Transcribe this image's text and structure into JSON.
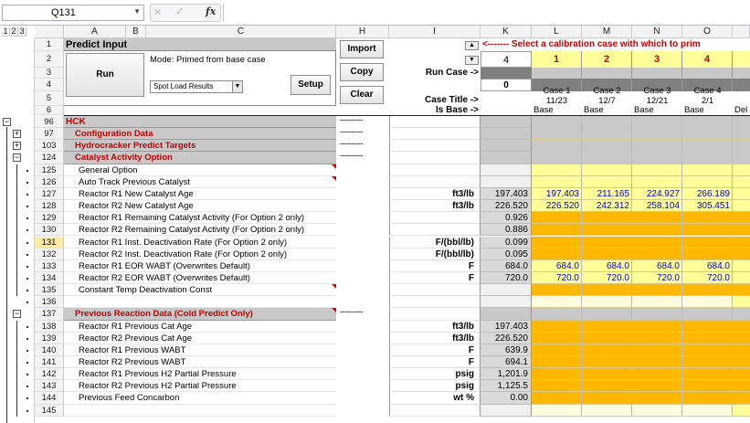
{
  "formula_bar": {
    "name_box": "Q131",
    "fx": "fx"
  },
  "outline_levels": [
    "1",
    "2",
    "3"
  ],
  "columns": [
    "A",
    "B",
    "C",
    "H",
    "I",
    "K",
    "L",
    "M",
    "N",
    "O"
  ],
  "panel": {
    "title": "Predict Input",
    "run": "Run",
    "mode": "Mode: Primed from base case",
    "dropdown": "Spot Load Results",
    "setup": "Setup",
    "import": "Import",
    "copy": "Copy",
    "clear": "Clear"
  },
  "header_area": {
    "calib_msg": "<------- Select a calibration case with which to prim",
    "run_case_label": "Run Case ->",
    "case_title_label": "Case Title ->",
    "is_base_label": "Is Base ->",
    "k2": "4",
    "k4": "0",
    "cases": [
      {
        "num": "1",
        "name": "Case 1",
        "date": "11/23",
        "base": "Base"
      },
      {
        "num": "2",
        "name": "Case 2",
        "date": "12/7",
        "base": "Base"
      },
      {
        "num": "3",
        "name": "Case 3",
        "date": "12/21",
        "base": "Base"
      },
      {
        "num": "4",
        "name": "Case 4",
        "date": "2/1",
        "base": "Base"
      }
    ],
    "p6": "Del"
  },
  "top_rows": [
    "1",
    "2",
    "3",
    "4",
    "5",
    "6"
  ],
  "rows": [
    {
      "r": "96",
      "label": "HCK",
      "indent": 0,
      "kind": "hck",
      "unit": "",
      "k": "",
      "vals": []
    },
    {
      "r": "97",
      "label": "Configuration Data",
      "indent": 1,
      "kind": "section",
      "unit": "",
      "k": "",
      "vals": []
    },
    {
      "r": "103",
      "label": "Hydrocracker Predict Targets",
      "indent": 1,
      "kind": "section",
      "unit": "",
      "k": "",
      "vals": []
    },
    {
      "r": "124",
      "label": "Catalyst Activity Option",
      "indent": 1,
      "kind": "section",
      "unit": "",
      "k": "",
      "vals": []
    },
    {
      "r": "125",
      "label": "General Option",
      "indent": 2,
      "kind": "item",
      "unit": "",
      "k": "",
      "vals": [],
      "tri": true
    },
    {
      "r": "126",
      "label": "Auto Track Previous Catalyst",
      "indent": 2,
      "kind": "item",
      "unit": "",
      "k": "",
      "vals": [],
      "tri": true
    },
    {
      "r": "127",
      "label": "Reactor R1 New Catalyst Age",
      "indent": 2,
      "kind": "item",
      "unit": "ft3/lb",
      "k": "197.403",
      "vals": [
        "197.403",
        "211.165",
        "224.927",
        "266.189"
      ]
    },
    {
      "r": "128",
      "label": "Reactor R2 New Catalyst Age",
      "indent": 2,
      "kind": "item",
      "unit": "ft3/lb",
      "k": "226.520",
      "vals": [
        "226.520",
        "242.312",
        "258.104",
        "305.451"
      ]
    },
    {
      "r": "129",
      "label": "Reactor R1 Remaining Catalyst Activity (For Option 2 only)",
      "indent": 2,
      "kind": "orange",
      "unit": "",
      "k": "0.926",
      "vals": []
    },
    {
      "r": "130",
      "label": "Reactor R2 Remaining Catalyst Activity (For Option 2 only)",
      "indent": 2,
      "kind": "orange",
      "unit": "",
      "k": "0.886",
      "vals": []
    },
    {
      "r": "131",
      "label": "Reactor R1 Inst. Deactivation Rate (For Option 2 only)",
      "indent": 2,
      "kind": "orange",
      "unit": "F/(bbl/lb)",
      "k": "0.099",
      "vals": [],
      "sel": true
    },
    {
      "r": "132",
      "label": "Reactor R2 Inst. Deactivation Rate (For Option 2 only)",
      "indent": 2,
      "kind": "orange",
      "unit": "F/(bbl/lb)",
      "k": "0.095",
      "vals": []
    },
    {
      "r": "133",
      "label": "Reactor R1 EOR WABT (Overwrites Default)",
      "indent": 2,
      "kind": "item",
      "unit": "F",
      "k": "684.0",
      "vals": [
        "684.0",
        "684.0",
        "684.0",
        "684.0"
      ]
    },
    {
      "r": "134",
      "label": "Reactor R2 EOR WABT (Overwrites Default)",
      "indent": 2,
      "kind": "item",
      "unit": "F",
      "k": "720.0",
      "vals": [
        "720.0",
        "720.0",
        "720.0",
        "720.0"
      ]
    },
    {
      "r": "135",
      "label": "Constant Temp Deactivation Const",
      "indent": 2,
      "kind": "orange",
      "unit": "",
      "k": "",
      "vals": [],
      "tri": true
    },
    {
      "r": "136",
      "label": "",
      "indent": 2,
      "kind": "blank",
      "unit": "",
      "k": "",
      "vals": []
    },
    {
      "r": "137",
      "label": "Previous Reaction Data (Cold Predict Only)",
      "indent": 1,
      "kind": "section",
      "unit": "",
      "k": "",
      "vals": [],
      "tri": true
    },
    {
      "r": "138",
      "label": "Reactor R1 Previous Cat Age",
      "indent": 2,
      "kind": "orange",
      "unit": "ft3/lb",
      "k": "197.403",
      "vals": []
    },
    {
      "r": "139",
      "label": "Reactor R2 Previous Cat Age",
      "indent": 2,
      "kind": "orange",
      "unit": "ft3/lb",
      "k": "226.520",
      "vals": []
    },
    {
      "r": "140",
      "label": "Reactor R1 Previous WABT",
      "indent": 2,
      "kind": "orange",
      "unit": "F",
      "k": "639.9",
      "vals": []
    },
    {
      "r": "141",
      "label": "Reactor R2 Previous WABT",
      "indent": 2,
      "kind": "orange",
      "unit": "F",
      "k": "694.1",
      "vals": []
    },
    {
      "r": "142",
      "label": "Reactor R1 Previous H2 Partial Pressure",
      "indent": 2,
      "kind": "orange",
      "unit": "psig",
      "k": "1,201.9",
      "vals": []
    },
    {
      "r": "143",
      "label": "Reactor R2 Previous H2 Partial Pressure",
      "indent": 2,
      "kind": "orange",
      "unit": "psig",
      "k": "1,125.5",
      "vals": []
    },
    {
      "r": "144",
      "label": "Previous Feed Concarbon",
      "indent": 2,
      "kind": "orange",
      "unit": "wt %",
      "k": "0.00",
      "vals": []
    },
    {
      "r": "145",
      "label": "",
      "indent": 2,
      "kind": "blank",
      "unit": "",
      "k": "",
      "vals": []
    }
  ],
  "dashes": "----------"
}
